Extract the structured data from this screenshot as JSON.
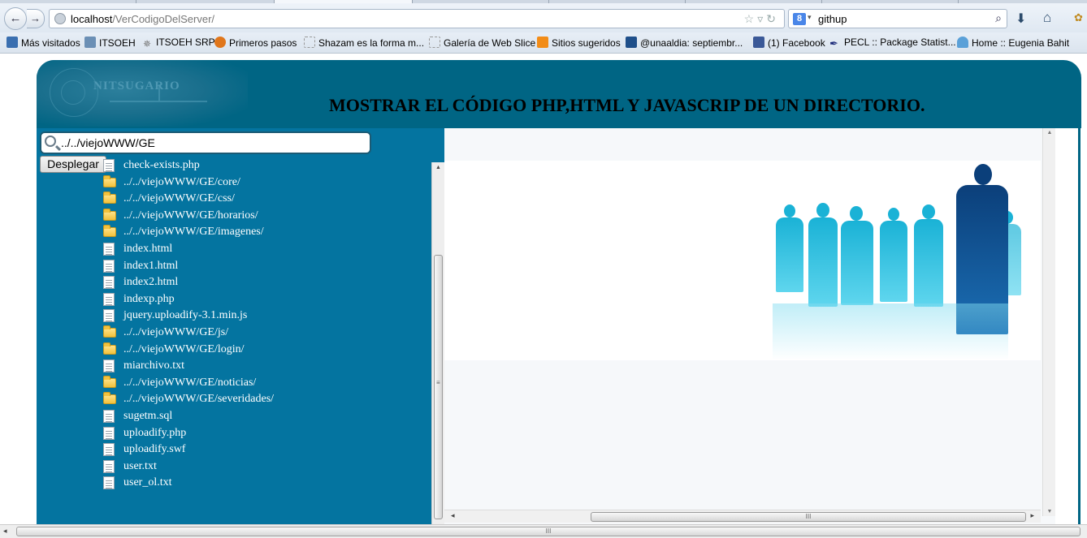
{
  "browser": {
    "url_host": "localhost",
    "url_path": "/VerCodigoDelServer/",
    "search_engine_letter": "8",
    "search_query": "githup"
  },
  "bookmarks": [
    {
      "label": "Más visitados",
      "icon": "bookmark-folder-icon",
      "color": "#3a6fb0"
    },
    {
      "label": "ITSOEH",
      "icon": "itsoeh-site-icon",
      "color": "#6b8fb5"
    },
    {
      "label": "ITSOEH SRPI",
      "icon": "asterisk-icon",
      "color": "#777777"
    },
    {
      "label": "Primeros pasos",
      "icon": "firefox-icon",
      "color": "#e0761b"
    },
    {
      "label": "Shazam es la forma m...",
      "icon": "web-slice-icon",
      "color": "#bbbbbb"
    },
    {
      "label": "Galería de Web Slice",
      "icon": "web-slice-icon",
      "color": "#bbbbbb"
    },
    {
      "label": "Sitios sugeridos",
      "icon": "lightbulb-icon",
      "color": "#f28c18"
    },
    {
      "label": "@unaaldia: septiembr...",
      "icon": "hispasec-icon",
      "color": "#1f4f8a"
    },
    {
      "label": "(1) Facebook",
      "icon": "facebook-icon",
      "color": "#3b5998"
    },
    {
      "label": "PECL :: Package Statist...",
      "icon": "feather-icon",
      "color": "#1b2a7a"
    },
    {
      "label": "Home :: Eugenia Bahit",
      "icon": "butterfly-icon",
      "color": "#5aa0d8"
    }
  ],
  "header": {
    "logo_text": "NITSUGARIO",
    "title": "MOSTRAR EL CÓDIGO PHP,HTML Y JAVASCRIP DE UN DIRECTORIO."
  },
  "explorer": {
    "path_value": "../../viejoWWW/GE",
    "button_label": "Desplegar",
    "items": [
      {
        "type": "file",
        "name": "check-exists.php"
      },
      {
        "type": "folder",
        "name": "../../viejoWWW/GE/core/"
      },
      {
        "type": "folder",
        "name": "../../viejoWWW/GE/css/"
      },
      {
        "type": "folder",
        "name": "../../viejoWWW/GE/horarios/"
      },
      {
        "type": "folder",
        "name": "../../viejoWWW/GE/imagenes/"
      },
      {
        "type": "file",
        "name": "index.html"
      },
      {
        "type": "file",
        "name": "index1.html"
      },
      {
        "type": "file",
        "name": "index2.html"
      },
      {
        "type": "file",
        "name": "indexp.php"
      },
      {
        "type": "file",
        "name": "jquery.uploadify-3.1.min.js"
      },
      {
        "type": "folder",
        "name": "../../viejoWWW/GE/js/"
      },
      {
        "type": "folder",
        "name": "../../viejoWWW/GE/login/"
      },
      {
        "type": "file",
        "name": "miarchivo.txt"
      },
      {
        "type": "folder",
        "name": "../../viejoWWW/GE/noticias/"
      },
      {
        "type": "folder",
        "name": "../../viejoWWW/GE/severidades/"
      },
      {
        "type": "file",
        "name": "sugetm.sql"
      },
      {
        "type": "file",
        "name": "uploadify.php"
      },
      {
        "type": "file",
        "name": "uploadify.swf"
      },
      {
        "type": "file",
        "name": "user.txt"
      },
      {
        "type": "file",
        "name": "user_ol.txt"
      }
    ]
  },
  "colors": {
    "app_background": "#006584",
    "left_panel": "#0474a0",
    "people_cyan": "#1ab2d6",
    "leader_blue": "#0b3f7a"
  }
}
